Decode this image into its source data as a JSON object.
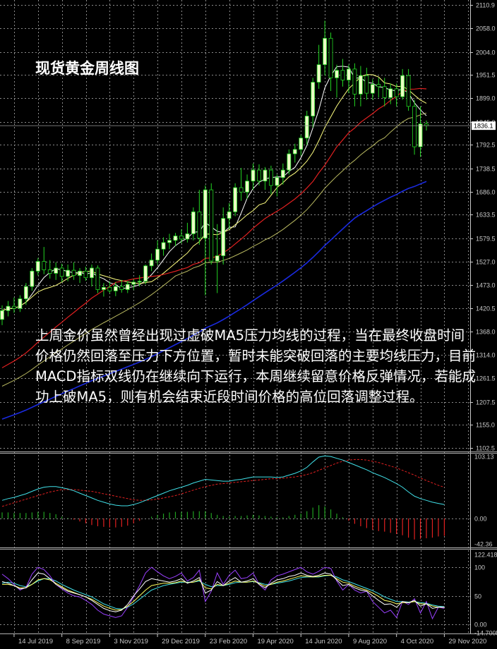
{
  "title": "现货黄金周线图",
  "annotation": "上周金价虽然曾经出现过虚破MA5压力均线的过程，当在最终收盘时间价格仍然回落至压力下方位置，暂时未能突破回落的主要均线压力，目前MACD指标双线仍在继续向下运行，本周继续留意价格反弹情况，若能成功上破MA5，则有机会结束近段时间价格的高位回落调整过程。",
  "colors": {
    "background": "#000000",
    "grid": "#8a8a8a",
    "axis": "#c8c8c8",
    "candle_fill": "#eaffc4",
    "candle_outline": "#22d422",
    "ma5": "#ffffff",
    "ma10": "#ffff80",
    "ma20": "#e02020",
    "ma30": "#b8b860",
    "ma60": "#1a2ae0",
    "macd_main": "#40e0e8",
    "macd_signal": "#e02020",
    "macd_hist_pos": "#20a020",
    "macd_hist_neg": "#e02020",
    "osc_violet": "#9a40ff",
    "osc_white": "#ffffff",
    "osc_yellow": "#ffff60",
    "osc_cyan": "#40e0e8",
    "price_tag_bg": "#ffffff",
    "price_tag_text": "#000000"
  },
  "chart_data": [
    {
      "type": "candlestick",
      "panel": "price",
      "ylim": [
        1102.5,
        2110.9
      ],
      "y_ticks": [
        "2110.9",
        "2058.0",
        "2004.0",
        "1951.5",
        "1899.0",
        "1845.0",
        "1792.5",
        "1738.5",
        "1686.0",
        "1633.5",
        "1579.5",
        "1527.0",
        "1473.0",
        "1420.5",
        "1368.0",
        "1314.0",
        "1261.5",
        "1207.5",
        "1155.0",
        "1102.5"
      ],
      "current_price": "1836.1",
      "x_labels": [
        "14 Jul 2019",
        "8 Sep 2019",
        "3 Nov 2019",
        "29 Dec 2019",
        "23 Feb 2020",
        "19 Apr 2020",
        "14 Jun 2020",
        "9 Aug 2020",
        "4 Oct 2020",
        "29 Nov 2020"
      ],
      "x_label_bar_index": [
        2,
        10,
        18,
        26,
        34,
        42,
        50,
        58,
        66,
        74
      ],
      "candles": [
        {
          "o": 1395,
          "h": 1427,
          "l": 1382,
          "c": 1415
        },
        {
          "o": 1415,
          "h": 1437,
          "l": 1402,
          "c": 1425
        },
        {
          "o": 1425,
          "h": 1445,
          "l": 1410,
          "c": 1420
        },
        {
          "o": 1420,
          "h": 1450,
          "l": 1412,
          "c": 1442
        },
        {
          "o": 1442,
          "h": 1478,
          "l": 1428,
          "c": 1470
        },
        {
          "o": 1470,
          "h": 1512,
          "l": 1460,
          "c": 1505
        },
        {
          "o": 1505,
          "h": 1535,
          "l": 1495,
          "c": 1527
        },
        {
          "o": 1527,
          "h": 1560,
          "l": 1498,
          "c": 1508
        },
        {
          "o": 1508,
          "h": 1530,
          "l": 1488,
          "c": 1500
        },
        {
          "o": 1500,
          "h": 1525,
          "l": 1485,
          "c": 1512
        },
        {
          "o": 1512,
          "h": 1522,
          "l": 1480,
          "c": 1493
        },
        {
          "o": 1493,
          "h": 1520,
          "l": 1482,
          "c": 1507
        },
        {
          "o": 1507,
          "h": 1525,
          "l": 1485,
          "c": 1495
        },
        {
          "o": 1495,
          "h": 1512,
          "l": 1478,
          "c": 1505
        },
        {
          "o": 1505,
          "h": 1515,
          "l": 1483,
          "c": 1490
        },
        {
          "o": 1490,
          "h": 1520,
          "l": 1470,
          "c": 1512
        },
        {
          "o": 1512,
          "h": 1518,
          "l": 1455,
          "c": 1463
        },
        {
          "o": 1463,
          "h": 1478,
          "l": 1447,
          "c": 1468
        },
        {
          "o": 1468,
          "h": 1482,
          "l": 1455,
          "c": 1460
        },
        {
          "o": 1460,
          "h": 1480,
          "l": 1448,
          "c": 1470
        },
        {
          "o": 1470,
          "h": 1485,
          "l": 1456,
          "c": 1463
        },
        {
          "o": 1463,
          "h": 1482,
          "l": 1455,
          "c": 1475
        },
        {
          "o": 1475,
          "h": 1487,
          "l": 1462,
          "c": 1480
        },
        {
          "o": 1480,
          "h": 1496,
          "l": 1470,
          "c": 1482
        },
        {
          "o": 1482,
          "h": 1520,
          "l": 1475,
          "c": 1517
        },
        {
          "o": 1517,
          "h": 1545,
          "l": 1505,
          "c": 1530
        },
        {
          "o": 1530,
          "h": 1575,
          "l": 1520,
          "c": 1555
        },
        {
          "o": 1555,
          "h": 1582,
          "l": 1540,
          "c": 1570
        },
        {
          "o": 1570,
          "h": 1590,
          "l": 1555,
          "c": 1575
        },
        {
          "o": 1575,
          "h": 1592,
          "l": 1562,
          "c": 1585
        },
        {
          "o": 1585,
          "h": 1600,
          "l": 1568,
          "c": 1578
        },
        {
          "o": 1578,
          "h": 1615,
          "l": 1570,
          "c": 1590
        },
        {
          "o": 1590,
          "h": 1650,
          "l": 1575,
          "c": 1640
        },
        {
          "o": 1640,
          "h": 1690,
          "l": 1565,
          "c": 1580
        },
        {
          "o": 1580,
          "h": 1700,
          "l": 1450,
          "c": 1690
        },
        {
          "o": 1690,
          "h": 1705,
          "l": 1520,
          "c": 1528
        },
        {
          "o": 1528,
          "h": 1612,
          "l": 1455,
          "c": 1540
        },
        {
          "o": 1540,
          "h": 1650,
          "l": 1520,
          "c": 1625
        },
        {
          "o": 1625,
          "h": 1660,
          "l": 1600,
          "c": 1640
        },
        {
          "o": 1640,
          "h": 1705,
          "l": 1630,
          "c": 1695
        },
        {
          "o": 1695,
          "h": 1740,
          "l": 1665,
          "c": 1685
        },
        {
          "o": 1685,
          "h": 1725,
          "l": 1670,
          "c": 1710
        },
        {
          "o": 1710,
          "h": 1750,
          "l": 1690,
          "c": 1735
        },
        {
          "o": 1735,
          "h": 1748,
          "l": 1700,
          "c": 1710
        },
        {
          "o": 1710,
          "h": 1742,
          "l": 1690,
          "c": 1735
        },
        {
          "o": 1735,
          "h": 1745,
          "l": 1680,
          "c": 1700
        },
        {
          "o": 1700,
          "h": 1725,
          "l": 1675,
          "c": 1718
        },
        {
          "o": 1718,
          "h": 1750,
          "l": 1702,
          "c": 1735
        },
        {
          "o": 1735,
          "h": 1782,
          "l": 1725,
          "c": 1772
        },
        {
          "o": 1772,
          "h": 1795,
          "l": 1752,
          "c": 1782
        },
        {
          "o": 1782,
          "h": 1815,
          "l": 1768,
          "c": 1808
        },
        {
          "o": 1808,
          "h": 1870,
          "l": 1792,
          "c": 1858
        },
        {
          "o": 1858,
          "h": 1945,
          "l": 1832,
          "c": 1935
        },
        {
          "o": 1935,
          "h": 2020,
          "l": 1920,
          "c": 1975
        },
        {
          "o": 1975,
          "h": 2075,
          "l": 1950,
          "c": 2035
        },
        {
          "o": 2035,
          "h": 2048,
          "l": 1915,
          "c": 1945
        },
        {
          "o": 1945,
          "h": 1975,
          "l": 1900,
          "c": 1962
        },
        {
          "o": 1962,
          "h": 1988,
          "l": 1925,
          "c": 1940
        },
        {
          "o": 1940,
          "h": 1975,
          "l": 1910,
          "c": 1965
        },
        {
          "o": 1965,
          "h": 1978,
          "l": 1880,
          "c": 1908
        },
        {
          "o": 1908,
          "h": 1972,
          "l": 1880,
          "c": 1950
        },
        {
          "o": 1950,
          "h": 1968,
          "l": 1895,
          "c": 1910
        },
        {
          "o": 1910,
          "h": 1942,
          "l": 1895,
          "c": 1930
        },
        {
          "o": 1930,
          "h": 1945,
          "l": 1900,
          "c": 1925
        },
        {
          "o": 1925,
          "h": 1945,
          "l": 1880,
          "c": 1900
        },
        {
          "o": 1900,
          "h": 1932,
          "l": 1885,
          "c": 1920
        },
        {
          "o": 1920,
          "h": 1932,
          "l": 1880,
          "c": 1902
        },
        {
          "o": 1902,
          "h": 1965,
          "l": 1895,
          "c": 1950
        },
        {
          "o": 1950,
          "h": 1965,
          "l": 1870,
          "c": 1880
        },
        {
          "o": 1880,
          "h": 1895,
          "l": 1770,
          "c": 1788
        },
        {
          "o": 1788,
          "h": 1880,
          "l": 1765,
          "c": 1840
        },
        {
          "o": 1840,
          "h": 1848,
          "l": 1825,
          "c": 1836
        }
      ],
      "ma_note": "MA5, MA10, MA20, MA30, MA60 computed from candle closes"
    },
    {
      "type": "macd",
      "panel": "MACD",
      "ylim": [
        -42.36,
        103.13
      ],
      "y_ticks": [
        "103.13",
        "0.00",
        "-42.36"
      ],
      "main": [
        30,
        33,
        35,
        38,
        41,
        45,
        49,
        52,
        53,
        53,
        51,
        49,
        46,
        42,
        38,
        34,
        30,
        27,
        24,
        22,
        21,
        21,
        23,
        26,
        30,
        34,
        38,
        42,
        46,
        49,
        52,
        55,
        59,
        62,
        65,
        64,
        63,
        62,
        62,
        64,
        65,
        67,
        69,
        69,
        69,
        69,
        68,
        69,
        72,
        75,
        79,
        85,
        94,
        102,
        104,
        103,
        100,
        97,
        93,
        89,
        85,
        81,
        76,
        72,
        68,
        63,
        58,
        52,
        44,
        37,
        33,
        30,
        27,
        25,
        23
      ],
      "signal": [
        20,
        23,
        26,
        29,
        32,
        35,
        38,
        41,
        44,
        46,
        48,
        48,
        48,
        47,
        46,
        45,
        43,
        41,
        39,
        37,
        35,
        33,
        31,
        30,
        30,
        31,
        32,
        34,
        36,
        38,
        41,
        44,
        47,
        50,
        53,
        55,
        57,
        58,
        59,
        60,
        61,
        62,
        63,
        64,
        65,
        66,
        66,
        67,
        68,
        69,
        71,
        73,
        76,
        80,
        84,
        88,
        92,
        95,
        97,
        98,
        98,
        97,
        95,
        93,
        90,
        87,
        84,
        80,
        76,
        72,
        67,
        63,
        59,
        55,
        52
      ],
      "hist": [
        10,
        10,
        9,
        9,
        9,
        10,
        11,
        11,
        9,
        7,
        3,
        1,
        -2,
        -5,
        -8,
        -11,
        -13,
        -14,
        -15,
        -15,
        -14,
        -12,
        -8,
        -4,
        0,
        3,
        6,
        8,
        10,
        11,
        11,
        11,
        12,
        12,
        12,
        9,
        6,
        4,
        3,
        4,
        4,
        5,
        6,
        5,
        4,
        3,
        2,
        2,
        4,
        6,
        8,
        12,
        18,
        22,
        20,
        15,
        8,
        2,
        -4,
        -9,
        -13,
        -16,
        -19,
        -21,
        -22,
        -24,
        -26,
        -28,
        -32,
        -35,
        -34,
        -33,
        -32,
        -30,
        -29
      ]
    },
    {
      "type": "oscillator",
      "panel": "oscillator",
      "ylim": [
        -14.7005,
        122.418
      ],
      "y_ticks": [
        "122.418",
        "100",
        "50",
        "0.00",
        "-14.7005"
      ],
      "levels": [
        100,
        50,
        0
      ],
      "violet": [
        88,
        80,
        70,
        60,
        65,
        88,
        100,
        96,
        85,
        70,
        62,
        55,
        50,
        48,
        42,
        35,
        25,
        18,
        15,
        12,
        15,
        30,
        48,
        68,
        90,
        100,
        92,
        85,
        80,
        84,
        90,
        76,
        82,
        95,
        40,
        58,
        90,
        70,
        86,
        95,
        80,
        82,
        90,
        70,
        60,
        78,
        85,
        88,
        92,
        96,
        100,
        92,
        88,
        93,
        100,
        98,
        76,
        60,
        70,
        60,
        55,
        58,
        40,
        30,
        20,
        25,
        12,
        40,
        35,
        45,
        20,
        40,
        10,
        30,
        28
      ],
      "white": [
        75,
        72,
        68,
        62,
        64,
        78,
        90,
        88,
        80,
        70,
        64,
        58,
        55,
        52,
        48,
        42,
        35,
        28,
        24,
        22,
        25,
        35,
        50,
        62,
        75,
        80,
        78,
        76,
        74,
        76,
        80,
        72,
        76,
        82,
        55,
        60,
        75,
        68,
        76,
        82,
        74,
        76,
        80,
        70,
        64,
        72,
        78,
        80,
        84,
        86,
        90,
        86,
        84,
        86,
        90,
        88,
        78,
        68,
        70,
        64,
        60,
        58,
        50,
        42,
        35,
        36,
        30,
        40,
        38,
        42,
        32,
        36,
        28,
        30,
        30
      ],
      "yellow": [
        70,
        70,
        68,
        64,
        64,
        70,
        78,
        80,
        78,
        72,
        66,
        60,
        56,
        52,
        48,
        44,
        38,
        32,
        28,
        25,
        26,
        32,
        40,
        50,
        60,
        68,
        70,
        72,
        72,
        73,
        76,
        73,
        74,
        78,
        64,
        62,
        70,
        68,
        72,
        76,
        74,
        74,
        76,
        72,
        67,
        70,
        74,
        76,
        79,
        82,
        85,
        84,
        83,
        84,
        86,
        86,
        80,
        74,
        72,
        67,
        63,
        60,
        55,
        49,
        42,
        40,
        36,
        38,
        38,
        40,
        36,
        36,
        32,
        30,
        30
      ],
      "cyan": [
        72,
        74,
        72,
        68,
        66,
        70,
        76,
        80,
        80,
        76,
        70,
        65,
        60,
        56,
        52,
        48,
        42,
        36,
        32,
        28,
        27,
        30,
        36,
        44,
        52,
        60,
        64,
        68,
        70,
        72,
        74,
        74,
        74,
        76,
        70,
        66,
        68,
        68,
        70,
        73,
        74,
        74,
        75,
        73,
        70,
        70,
        72,
        74,
        76,
        79,
        82,
        83,
        83,
        83,
        85,
        86,
        83,
        78,
        75,
        71,
        67,
        63,
        59,
        54,
        48,
        44,
        40,
        40,
        39,
        40,
        38,
        37,
        34,
        32,
        31
      ]
    }
  ]
}
